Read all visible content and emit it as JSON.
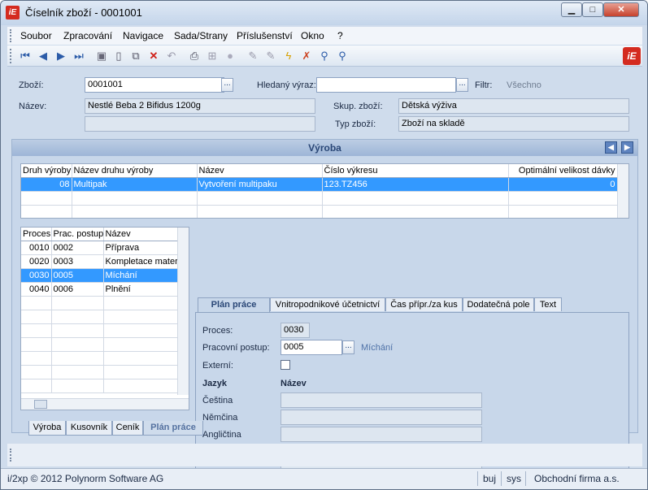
{
  "window": {
    "title": "Číselník zboží - 0001001",
    "app_icon": "iE"
  },
  "menu": [
    "Soubor",
    "Zpracování",
    "Navigace",
    "Sada/Strany",
    "Příslušenství",
    "Okno",
    "?"
  ],
  "toolbar_icons": [
    "first-icon",
    "prev-icon",
    "next-icon",
    "last-icon",
    "save-icon",
    "new-icon",
    "copy-icon",
    "delete-icon",
    "undo-icon",
    "print-icon",
    "tree-icon",
    "disabled-icon",
    "edit-icon",
    "edit2-icon",
    "filter-icon",
    "filter-clear-icon",
    "search-icon",
    "search-advanced-icon"
  ],
  "form": {
    "zbozi_label": "Zboží:",
    "zbozi_value": "0001001",
    "hledany_label": "Hledaný výraz:",
    "hledany_value": "",
    "filtr_label": "Filtr:",
    "filtr_value": "Všechno",
    "nazev_label": "Název:",
    "nazev_value": "Nestlé Beba 2 Bifidus 1200g",
    "nazev2_value": "",
    "skup_label": "Skup. zboží:",
    "skup_value": "Dětská výživa",
    "typ_label": "Typ zboží:",
    "typ_value": "Zboží na skladě"
  },
  "vyroba": {
    "title": "Výroba",
    "columns": [
      "Druh výroby",
      "Název druhu výroby",
      "Název",
      "Číslo výkresu",
      "Optimální velikost dávky"
    ],
    "rows": [
      [
        "08",
        "Multipak",
        "Vytvoření multipaku",
        "123.TZ456",
        "0"
      ]
    ]
  },
  "proces": {
    "columns": [
      "Proces",
      "Prac. postup",
      "Název"
    ],
    "rows": [
      [
        "0010",
        "0002",
        "Příprava"
      ],
      [
        "0020",
        "0003",
        "Kompletace materi"
      ],
      [
        "0030",
        "0005",
        "Míchání"
      ],
      [
        "0040",
        "0006",
        "Plnění"
      ]
    ],
    "selected": 2
  },
  "tabs": [
    "Plán práce",
    "Vnitropodnikové účetnictví",
    "Čas přípr./za kus",
    "Dodatečná pole",
    "Text"
  ],
  "plan": {
    "proces_label": "Proces:",
    "proces_value": "0030",
    "postup_label": "Pracovní postup:",
    "postup_value": "0005",
    "postup_name": "Míchání",
    "externi_label": "Externí:",
    "jazyk_header": "Jazyk",
    "nazev_header": "Název",
    "lang": [
      "Čeština",
      "Němčina",
      "Angličtina"
    ]
  },
  "bottom_tabs": [
    "Výroba",
    "Kusovník",
    "Ceník",
    "Plán práce"
  ],
  "status": {
    "copyright": "i/2xp © 2012 Polynorm Software AG",
    "user": "buj",
    "db": "sys",
    "company": "Obchodní firma a.s."
  }
}
